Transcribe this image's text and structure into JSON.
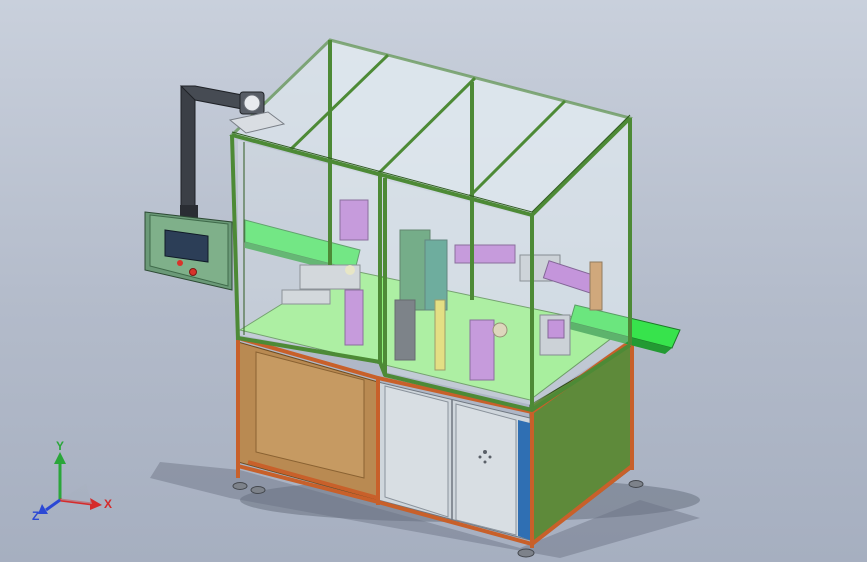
{
  "viewport": {
    "background_top": "#c9d0dc",
    "background_bottom": "#a6afc0"
  },
  "model": {
    "frame_color": "#4d8a36",
    "glass_color": "#dfe8ee",
    "cabinet_side_color": "#5e8a3a",
    "cabinet_front_color": "#b98a52",
    "base_frame_color": "#c8602a",
    "door_color": "#cfd6dc",
    "conveyor_color": "#37e34c",
    "deck_color": "#8ff07a",
    "part_accent_color": "#b66fd1",
    "hmi_panel_color": "#7fb08a",
    "hmi_screen_color": "#2c3e57",
    "stop_button_color": "#d9332a",
    "arm_color": "#3b3f46"
  },
  "triad": {
    "x_label": "X",
    "y_label": "Y",
    "z_label": "Z",
    "x_color": "#d52b2b",
    "y_color": "#2aa63a",
    "z_color": "#2b48d5"
  }
}
